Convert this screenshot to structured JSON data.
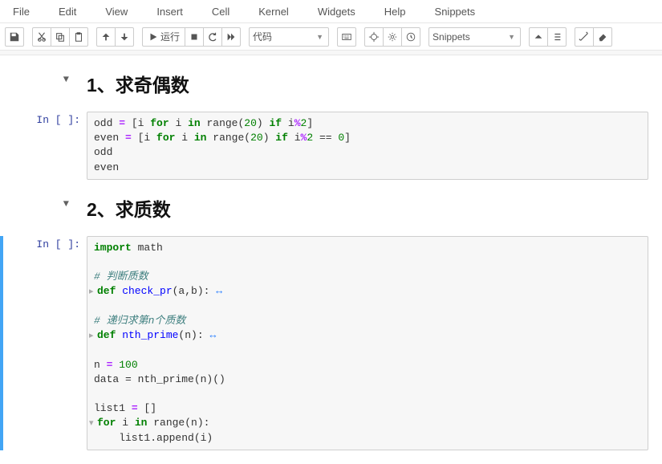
{
  "menu": {
    "file": "File",
    "edit": "Edit",
    "view": "View",
    "insert": "Insert",
    "cell": "Cell",
    "kernel": "Kernel",
    "widgets": "Widgets",
    "help": "Help",
    "snippets": "Snippets"
  },
  "toolbar": {
    "run_label": "运行",
    "celltype_value": "代码",
    "snippet_value": "Snippets"
  },
  "cells": {
    "h1": {
      "text": "1、求奇偶数"
    },
    "c1": {
      "prompt": "In  [ ]:",
      "code": {
        "l1a": "odd ",
        "l1b": "=",
        "l1c": " [i ",
        "l1d": "for",
        "l1e": " i ",
        "l1f": "in",
        "l1g": " range(",
        "l1h": "20",
        "l1i": ") ",
        "l1j": "if",
        "l1k": " i",
        "l1l": "%",
        "l1m": "2",
        "l1n": "]",
        "l2a": "even ",
        "l2b": "=",
        "l2c": " [i ",
        "l2d": "for",
        "l2e": " i ",
        "l2f": "in",
        "l2g": " range(",
        "l2h": "20",
        "l2i": ") ",
        "l2j": "if",
        "l2k": " i",
        "l2l": "%",
        "l2m": "2",
        "l2n": " == ",
        "l2o": "0",
        "l2p": "]",
        "l3": "odd",
        "l4": "even"
      }
    },
    "h2": {
      "text": "2、求质数"
    },
    "c2": {
      "prompt": "In  [ ]:",
      "code": {
        "l1a": "import",
        "l1b": " math",
        "l3": "# 判断质数",
        "l4a": "def",
        "l4b": " check_pr",
        "l4c": "(a,b):",
        "l6": "# 递归求第n个质数",
        "l7a": "def",
        "l7b": " nth_prime",
        "l7c": "(n):",
        "l9a": "n ",
        "l9b": "=",
        "l9c": " 100",
        "l10": "data = nth_prime(n)()",
        "l12a": "list1 ",
        "l12b": "=",
        "l12c": " []",
        "l13a": "for",
        "l13b": " i ",
        "l13c": "in",
        "l13d": " range(n):",
        "l14": "    list1.append(i)"
      }
    }
  }
}
